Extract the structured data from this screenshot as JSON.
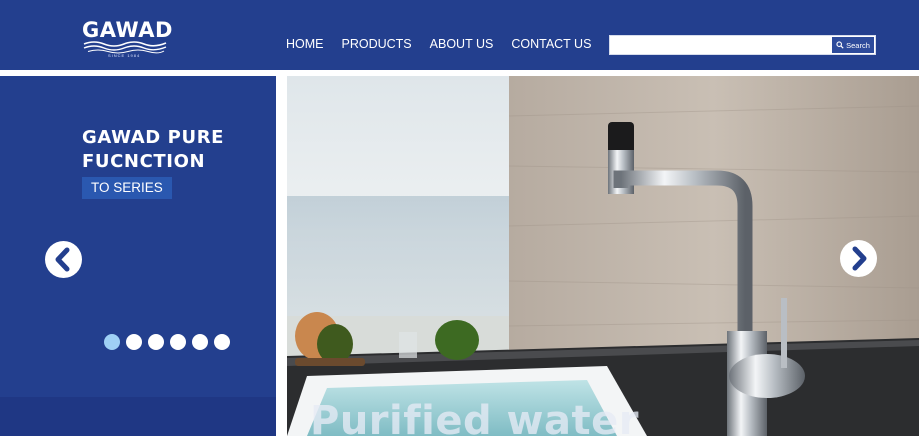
{
  "brand": {
    "logo_text": "GAWAD",
    "logo_tagline": "SINCE 1984"
  },
  "nav": {
    "items": [
      {
        "label": "HOME"
      },
      {
        "label": "PRODUCTS"
      },
      {
        "label": "ABOUT US"
      },
      {
        "label": "CONTACT US"
      }
    ]
  },
  "search": {
    "value": "",
    "placeholder": "",
    "button_label": "Search",
    "icon": "search-icon"
  },
  "hero": {
    "title_line1": "GAWAD PURE",
    "title_line2": "FUCNCTION",
    "series_label": "TO SERIES",
    "image_caption": "Purified water",
    "slide_count": 6,
    "active_slide": 1
  },
  "colors": {
    "primary": "#233f8e",
    "badge": "#2a58b0",
    "active_dot": "#9fd0f5"
  },
  "icons": {
    "prev": "chevron-left-icon",
    "next": "chevron-right-icon"
  }
}
